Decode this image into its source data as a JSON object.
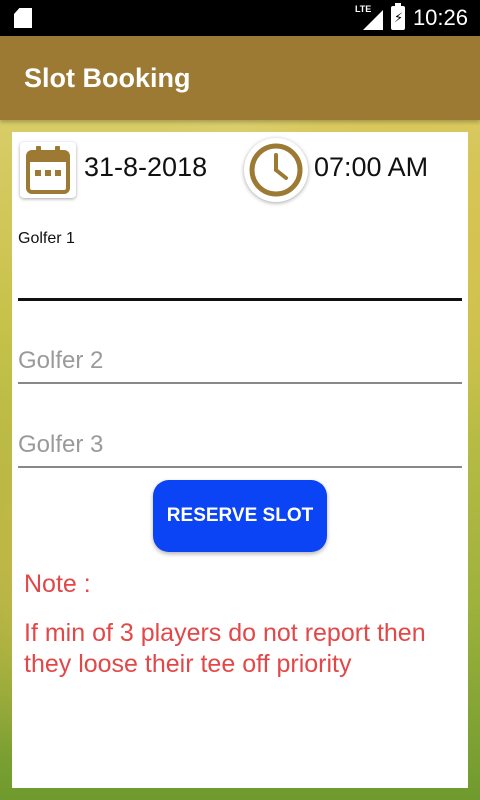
{
  "status_bar": {
    "network": "LTE",
    "time": "10:26"
  },
  "app_bar": {
    "title": "Slot Booking",
    "color": "#9c7a34"
  },
  "booking": {
    "date": "31-8-2018",
    "time": "07:00 AM",
    "golfer1": {
      "label": "Golfer 1",
      "value": ""
    },
    "golfer2": {
      "placeholder": "Golfer 2"
    },
    "golfer3": {
      "placeholder": "Golfer 3"
    },
    "reserve_label": "RESERVE SLOT",
    "reserve_color": "#0a44f5"
  },
  "note": {
    "label": "Note :",
    "text": "If min of 3 players do not report then they loose their tee off priority",
    "color": "#e24848"
  },
  "icons": {
    "calendar": "calendar-icon",
    "clock": "clock-icon",
    "sd_card": "sd-card-icon",
    "signal": "signal-icon",
    "battery": "battery-charging-icon"
  }
}
